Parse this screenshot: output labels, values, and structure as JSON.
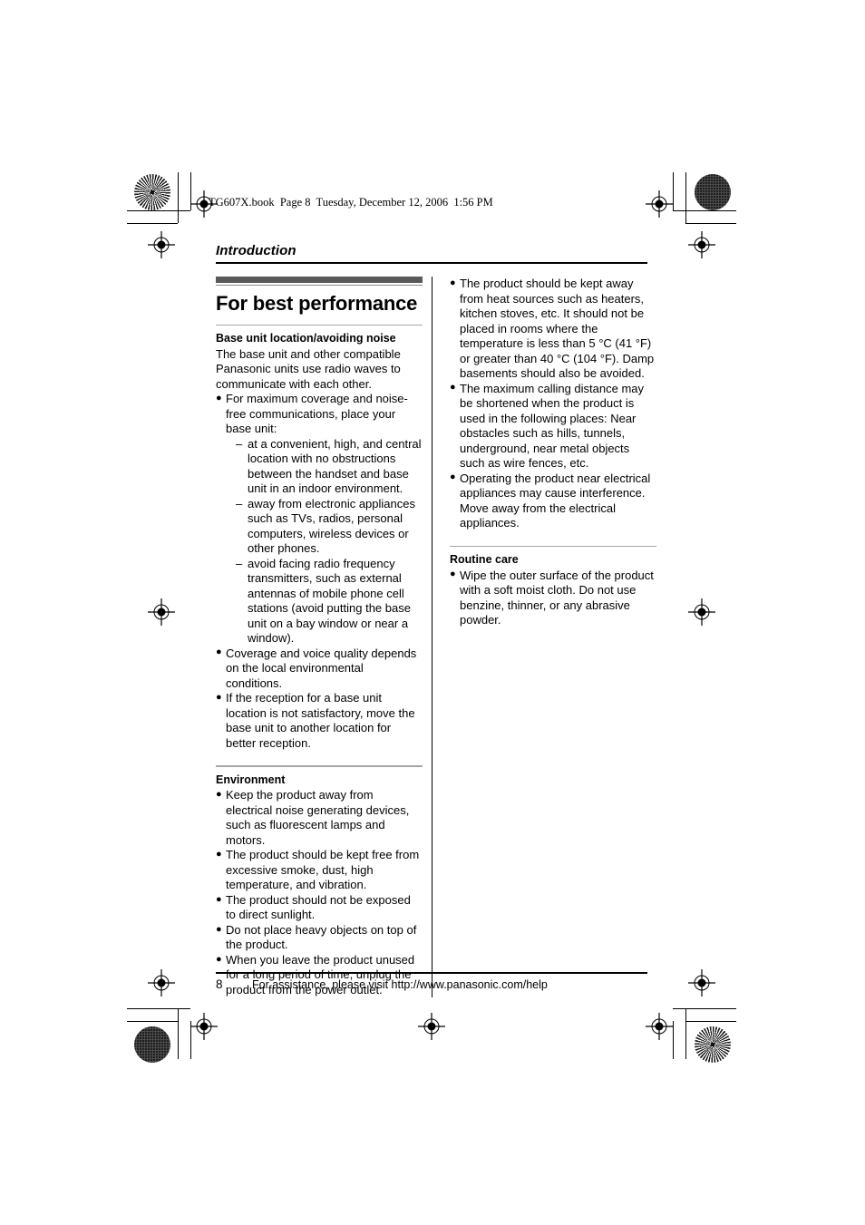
{
  "file_header": "TG607X.book  Page 8  Tuesday, December 12, 2006  1:56 PM",
  "running_head": "Introduction",
  "chapter_title": "For best performance",
  "colors": {
    "chapter_bar": "#595959",
    "subsection_rule": "#a6a6a6",
    "text": "#000000",
    "page_background": "#ffffff"
  },
  "left_column": {
    "section_1": {
      "heading": "Base unit location/avoiding noise",
      "intro_paragraph": "The base unit and other compatible Panasonic units use radio waves to communicate with each other.",
      "bullets": [
        {
          "text": "For maximum coverage and noise-free communications, place your base unit:",
          "sub_items": [
            "at a convenient, high, and central location with no obstructions between the handset and base unit in an indoor environment.",
            "away from electronic appliances such as TVs, radios, personal computers, wireless devices or other phones.",
            "avoid facing radio frequency transmitters, such as external antennas of mobile phone cell stations (avoid putting the base unit on a bay window or near a window)."
          ]
        },
        {
          "text": "Coverage and voice quality depends on the local environmental conditions.",
          "sub_items": []
        },
        {
          "text": "If the reception for a base unit location is not satisfactory, move the base unit to another location for better reception.",
          "sub_items": []
        }
      ]
    },
    "section_2": {
      "heading": "Environment",
      "bullets": [
        "Keep the product away from electrical noise generating devices, such as fluorescent lamps and motors.",
        "The product should be kept free from excessive smoke, dust, high temperature, and vibration.",
        "The product should not be exposed to direct sunlight.",
        "Do not place heavy objects on top of the product.",
        "When you leave the product unused for a long period of time, unplug the product from the power outlet."
      ]
    }
  },
  "right_column": {
    "section_1_continued": {
      "bullets": [
        "The product should be kept away from heat sources such as heaters, kitchen stoves, etc. It should not be placed in rooms where the temperature is less than 5 °C (41 °F) or greater than 40 °C (104 °F). Damp basements should also be avoided.",
        "The maximum calling distance may be shortened when the product is used in the following places: Near obstacles such as hills, tunnels, underground, near metal objects such as wire fences, etc.",
        "Operating the product near electrical appliances may cause interference. Move away from the electrical appliances."
      ]
    },
    "section_2": {
      "heading": "Routine care",
      "bullets": [
        "Wipe the outer surface of the product with a soft moist cloth. Do not use benzine, thinner, or any abrasive powder."
      ]
    }
  },
  "footer": {
    "page_number": "8",
    "assistance_text": "For assistance, please visit http://www.panasonic.com/help"
  },
  "marks": {
    "bullet_glyph": "●",
    "dash_glyph": "–"
  }
}
